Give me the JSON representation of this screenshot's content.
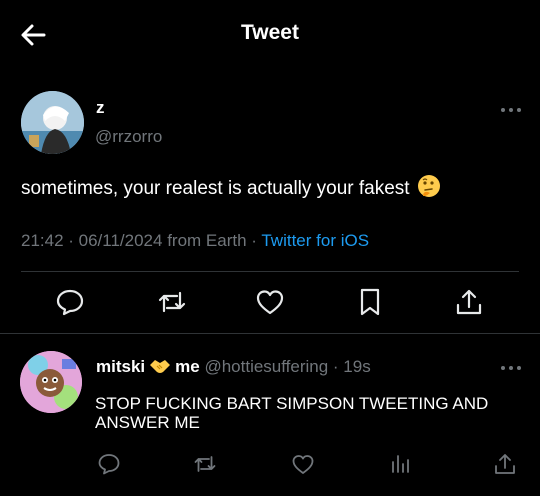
{
  "header": {
    "title": "Tweet",
    "back_icon": "arrow-left-icon"
  },
  "tweet": {
    "author_name": "z",
    "author_handle": "@rrzorro",
    "text": "sometimes, your realest is actually your fakest",
    "emoji": "thinking-face",
    "timestamp": "21:42 · 06/11/2024 from Earth · ",
    "client": "Twitter for iOS",
    "actions": [
      "reply-icon",
      "retweet-icon",
      "like-icon",
      "bookmark-icon",
      "share-icon"
    ]
  },
  "reply": {
    "name_part1": "mitski",
    "name_part2": "me",
    "handle": "@hottiesuffering",
    "time": " · 19s",
    "text": "STOP FUCKING BART SIMPSON TWEETING AND ANSWER ME",
    "actions": [
      "reply-icon",
      "retweet-icon",
      "like-icon",
      "views-icon",
      "share-icon"
    ]
  },
  "colors": {
    "background": "#000000",
    "text": "#e7e9ea",
    "muted": "#71767b",
    "accent": "#1d9bf0",
    "divider": "#2f3336"
  }
}
